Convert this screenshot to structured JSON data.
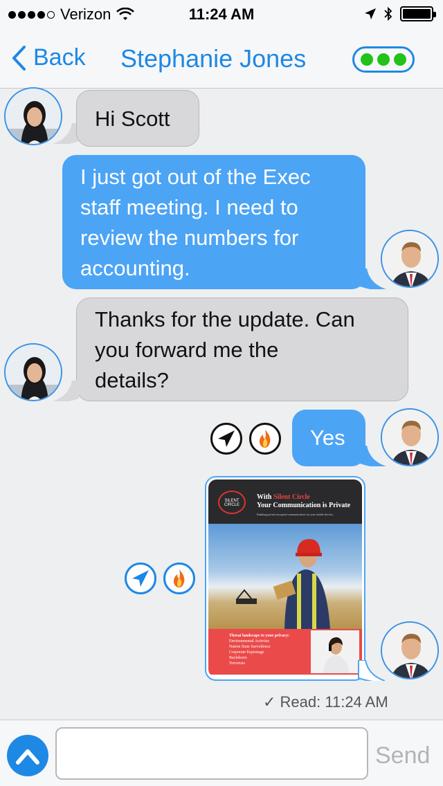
{
  "status_bar": {
    "carrier": "Verizon",
    "time": "11:24 AM",
    "signal_bars_filled": 4,
    "signal_bars_total": 5,
    "icons": [
      "wifi-icon",
      "location-arrow-icon",
      "bluetooth-icon",
      "battery-icon"
    ]
  },
  "nav": {
    "back_label": "Back",
    "title": "Stephanie Jones",
    "more_icon": "three-green-dots-icon"
  },
  "messages": [
    {
      "from": "Stephanie Jones",
      "direction": "incoming",
      "text": "Hi Scott"
    },
    {
      "from": "Scott",
      "direction": "outgoing",
      "lines": [
        "I just got out of the Exec",
        "staff meeting. I need to",
        "review the numbers for",
        "accounting."
      ]
    },
    {
      "from": "Stephanie Jones",
      "direction": "incoming",
      "lines": [
        "Thanks for the update. Can",
        "you forward me the",
        "details?"
      ]
    },
    {
      "from": "Scott",
      "direction": "outgoing",
      "text": "Yes"
    }
  ],
  "attachment": {
    "header_line1_prefix": "With ",
    "header_brand": "Silent Circle",
    "header_line2": "Your Communication is Private",
    "header_sub": "Enabling private encrypted communications for your mobile devices.",
    "logo_text": "SILENT CIRCLE",
    "footer_title": "Threat landscape to your privacy:",
    "footer_items": [
      "Environmental Activists",
      "Nation State Surveilence",
      "Corporate Espionage",
      "Backdoors",
      "Terrorists"
    ]
  },
  "read_receipt": "✓ Read: 11:24 AM",
  "composer": {
    "value": "",
    "send_label": "Send"
  },
  "colors": {
    "accent": "#1e88e5",
    "outgoing_bubble": "#4ca4f5",
    "incoming_bubble": "#d8d8da",
    "online_dot": "#23c21a",
    "burn_flame": "#f26a1b"
  }
}
